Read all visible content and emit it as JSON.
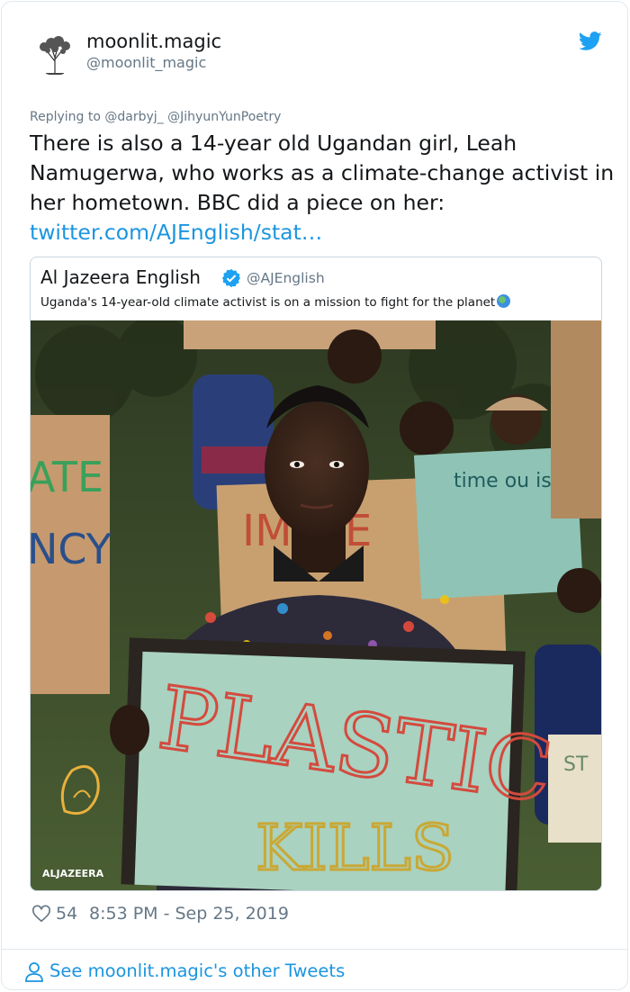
{
  "author": {
    "display_name": "moonlit.magic",
    "handle": "@moonlit_magic"
  },
  "reply": {
    "prefix": "Replying to",
    "mentions": [
      "@darbyj_",
      "@JihyunYunPoetry"
    ]
  },
  "tweet": {
    "text": "There is also a 14-year old Ugandan girl, Leah Namugerwa, who works as a climate-change activist in her hometown. BBC did a piece on her:",
    "link": "twitter.com/AJEnglish/stat…"
  },
  "quote": {
    "name": "Al Jazeera English",
    "handle": "@AJEnglish",
    "text": "Uganda's 14-year-old climate activist is on a mission to fight for the planet",
    "media": {
      "logo_text": "ALJAZEERA",
      "sign_main": "PLASTIC",
      "sign_main_sub": "KILLS",
      "sign_left": "ATE NCY",
      "sign_middle": "IMATE",
      "sign_right": "time ou is",
      "sign_far_right": "ST"
    }
  },
  "footer": {
    "likes": "54",
    "timestamp": "8:53 PM - Sep 25, 2019",
    "see_more": "See moonlit.magic's other Tweets"
  },
  "colors": {
    "link": "#1b95e0",
    "muted": "#657786",
    "twitter_blue": "#1da1f2"
  },
  "icons": [
    "tree-avatar-icon",
    "twitter-bird-icon",
    "verified-badge-icon",
    "globe-emoji-icon",
    "heart-icon",
    "person-icon"
  ]
}
